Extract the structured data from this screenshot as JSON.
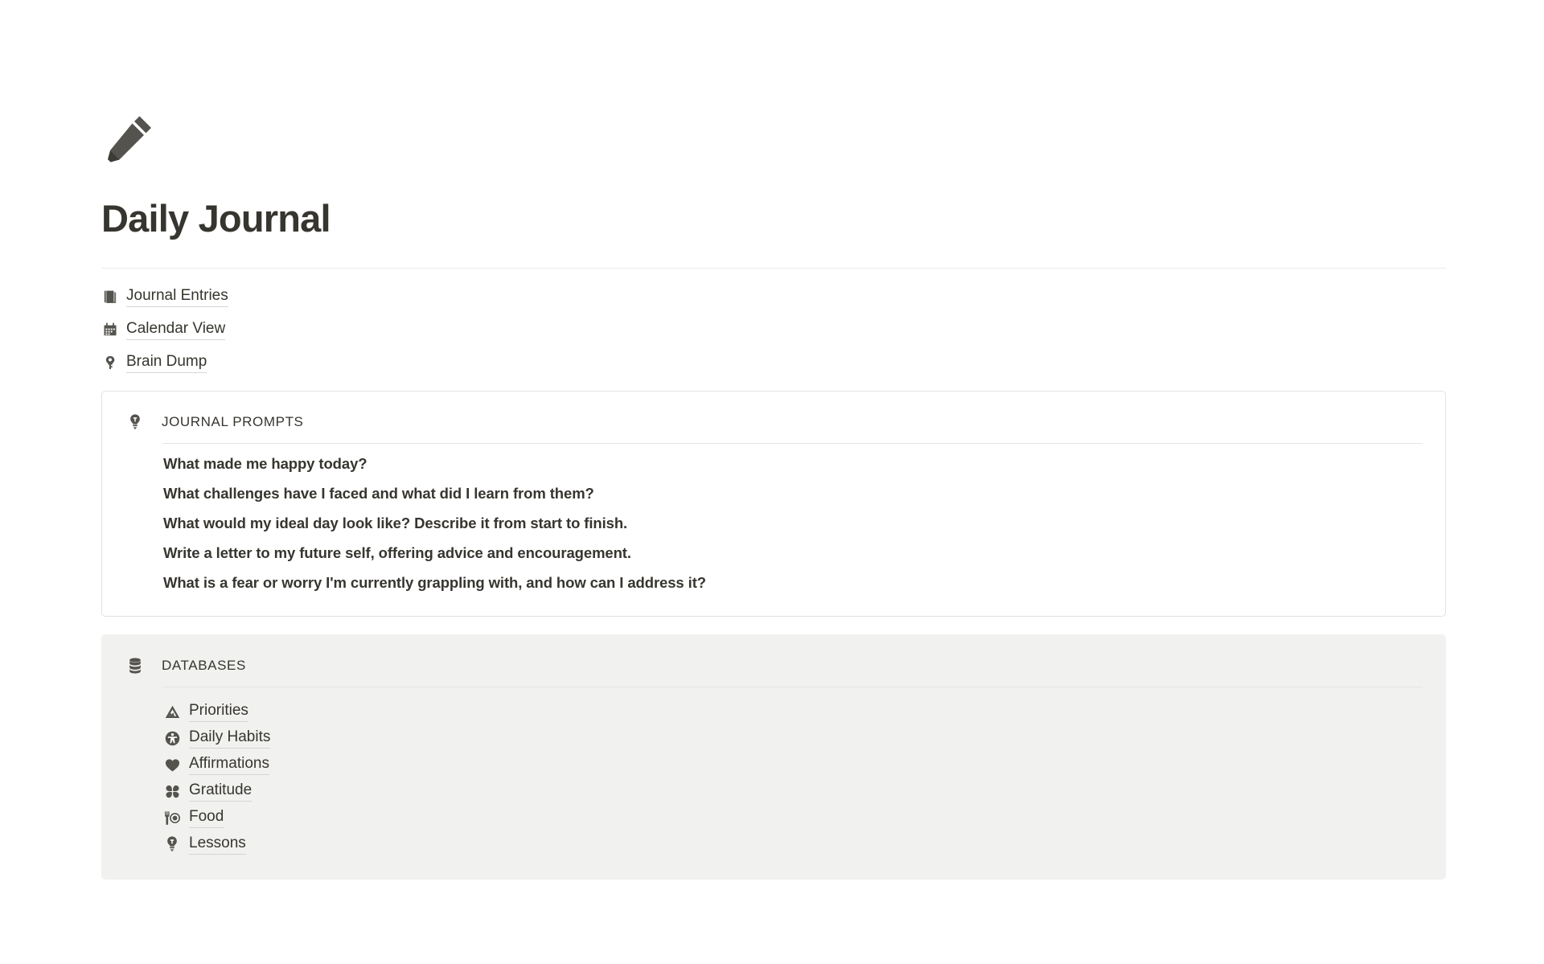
{
  "page": {
    "icon": "pencil-icon",
    "title": "Daily Journal"
  },
  "nav_links": [
    {
      "icon": "notebook-icon",
      "label": "Journal Entries"
    },
    {
      "icon": "calendar-icon",
      "label": "Calendar View"
    },
    {
      "icon": "brain-icon",
      "label": "Brain Dump"
    }
  ],
  "journal_prompts": {
    "icon": "lightbulb-icon",
    "heading": "JOURNAL PROMPTS",
    "items": [
      "What made me happy today?",
      "What challenges have I faced and what did I learn from them?",
      "What would my ideal day look like? Describe it from start to finish.",
      "Write a letter to my future self, offering advice and encouragement.",
      "What is a fear or worry I'm currently grappling with, and how can I address it?"
    ]
  },
  "databases": {
    "icon": "database-icon",
    "heading": "DATABASES",
    "items": [
      {
        "icon": "mountain-icon",
        "label": "Priorities"
      },
      {
        "icon": "accessibility-icon",
        "label": "Daily Habits"
      },
      {
        "icon": "heart-icon",
        "label": "Affirmations"
      },
      {
        "icon": "clover-icon",
        "label": "Gratitude"
      },
      {
        "icon": "food-icon",
        "label": "Food"
      },
      {
        "icon": "lightbulb-icon",
        "label": "Lessons"
      }
    ]
  },
  "colors": {
    "text": "#37352f",
    "icon": "#55534d",
    "card_border": "#e3e2e0",
    "card_gray_bg": "#f1f1ef",
    "divider": "#ececeb",
    "link_underline": "#d6d5d2"
  }
}
